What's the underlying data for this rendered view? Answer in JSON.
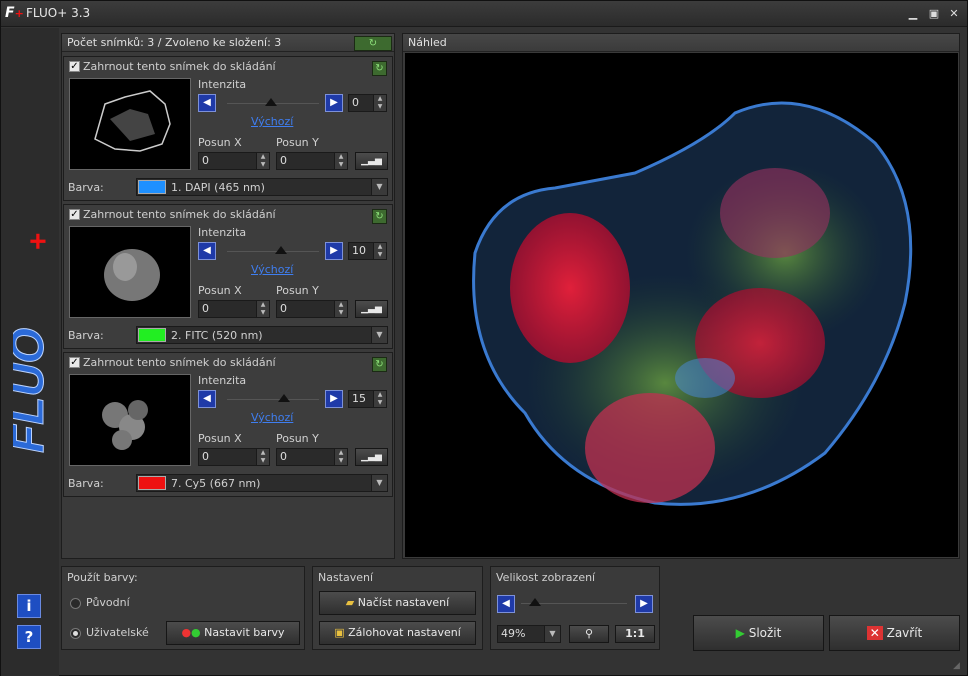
{
  "window": {
    "title": "FLUO+ 3.3",
    "logo_text": "FLUO",
    "logo_plus": "+"
  },
  "left_panel": {
    "header": "Počet snímků: 3 / Zvoleno ke složení: 3"
  },
  "layers": [
    {
      "include_label": "Zahrnout tento snímek do skládání",
      "intensity_label": "Intenzita",
      "default_link": "Výchozí",
      "intensity_value": "0",
      "shift_x_label": "Posun  X",
      "shift_y_label": "Posun Y",
      "shift_x": "0",
      "shift_y": "0",
      "color_label": "Barva:",
      "color_name": "1. DAPI (465 nm)",
      "color": "#1e90ff"
    },
    {
      "include_label": "Zahrnout tento snímek do skládání",
      "intensity_label": "Intenzita",
      "default_link": "Výchozí",
      "intensity_value": "10",
      "shift_x_label": "Posun  X",
      "shift_y_label": "Posun Y",
      "shift_x": "0",
      "shift_y": "0",
      "color_label": "Barva:",
      "color_name": "2. FITC (520 nm)",
      "color": "#22ee22"
    },
    {
      "include_label": "Zahrnout tento snímek do skládání",
      "intensity_label": "Intenzita",
      "default_link": "Výchozí",
      "intensity_value": "15",
      "shift_x_label": "Posun  X",
      "shift_y_label": "Posun Y",
      "shift_x": "0",
      "shift_y": "0",
      "color_label": "Barva:",
      "color_name": "7. Cy5 (667 nm)",
      "color": "#ee1111"
    }
  ],
  "preview": {
    "header": "Náhled"
  },
  "colors_group": {
    "header": "Použít barvy:",
    "original": "Původní",
    "user": "Uživatelské",
    "set_colors": "Nastavit barvy"
  },
  "settings_group": {
    "header": "Nastavení",
    "load": "Načíst nastavení",
    "backup": "Zálohovat nastavení"
  },
  "zoom_group": {
    "header": "Velikost zobrazení",
    "zoom_value": "49%",
    "one_to_one": "1:1"
  },
  "actions": {
    "compose": "Složit",
    "close": "Zavřít"
  },
  "help": {
    "info": "i",
    "help": "?"
  }
}
